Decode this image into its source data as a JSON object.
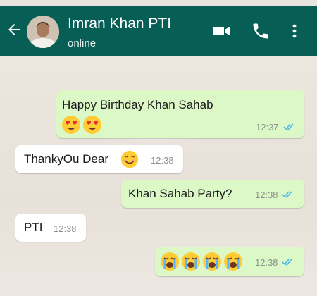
{
  "header": {
    "title": "Imran Khan PTI",
    "status": "online"
  },
  "messages": [
    {
      "direction": "outgoing",
      "text": "Happy Birthday Khan Sahab",
      "emojis": [
        "heart-eyes",
        "heart-eyes"
      ],
      "time": "12:37",
      "read": true
    },
    {
      "direction": "incoming",
      "text": "ThankyOu Dear",
      "emojis": [
        "smiling-face"
      ],
      "time": "12:38"
    },
    {
      "direction": "outgoing",
      "text": "Khan Sahab Party?",
      "time": "12:38",
      "read": true
    },
    {
      "direction": "incoming",
      "text": "PTI",
      "time": "12:38"
    },
    {
      "direction": "outgoing",
      "text": "",
      "emojis": [
        "crying-face",
        "crying-face",
        "crying-face",
        "crying-face"
      ],
      "time": "12:38",
      "read": true
    }
  ],
  "colors": {
    "header": "#075e54",
    "outgoing_bubble": "#dcf8c6",
    "incoming_bubble": "#ffffff",
    "read_ticks": "#4fb6ec"
  }
}
